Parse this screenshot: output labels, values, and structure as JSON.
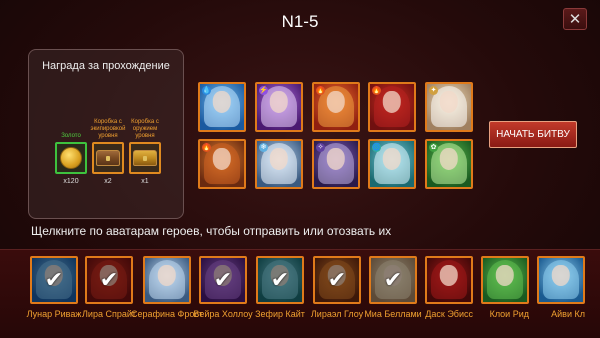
{
  "title": "N1-5",
  "close_label": "✕",
  "reward": {
    "title": "Награда за прохождение",
    "items": [
      {
        "label": "Золото",
        "count": "x120",
        "icon": "gold-coin-icon"
      },
      {
        "label": "Коробка с экипировкой уровня",
        "count": "x2",
        "icon": "equipment-box-icon"
      },
      {
        "label": "Коробка с оружием уровня",
        "count": "x1",
        "icon": "weapon-box-icon"
      }
    ]
  },
  "team": [
    {
      "element": "water",
      "c1": "#1a5aa0",
      "c2": "#7ac0f0",
      "hair": "#bfe4ff"
    },
    {
      "element": "lightning",
      "c1": "#4a1a70",
      "c2": "#b070e0",
      "hair": "#e8d0f8"
    },
    {
      "element": "fire",
      "c1": "#902010",
      "c2": "#f07030",
      "hair": "#f0a040"
    },
    {
      "element": "fire",
      "c1": "#701010",
      "c2": "#d03020",
      "hair": "#b82020"
    },
    {
      "element": "light",
      "c1": "#a08060",
      "c2": "#f0e0c0",
      "hair": "#ffffff"
    },
    {
      "element": "fire",
      "c1": "#6a2a10",
      "c2": "#e08030",
      "hair": "#d06020"
    },
    {
      "element": "ice",
      "c1": "#3a5a80",
      "c2": "#c0d8f0",
      "hair": "#f0f8ff"
    },
    {
      "element": "dark",
      "c1": "#2a1a4a",
      "c2": "#8060c0",
      "hair": "#c0b0e0"
    },
    {
      "element": "wind",
      "c1": "#1a6a70",
      "c2": "#80d0e0",
      "hair": "#e0f8ff"
    },
    {
      "element": "nature",
      "c1": "#1a5a20",
      "c2": "#60c050",
      "hair": "#c0f0a0"
    }
  ],
  "start_button": "НАЧАТЬ БИТВУ",
  "hint": "Щелкните по аватарам героев, чтобы отправить или отозвать их",
  "roster": [
    {
      "name": "Лунар Риваж",
      "selected": true,
      "c1": "#1a5aa0",
      "c2": "#7ac0f0"
    },
    {
      "name": "Лира Спрайт",
      "selected": true,
      "c1": "#701010",
      "c2": "#d03020"
    },
    {
      "name": "Серафина Фрост",
      "selected": false,
      "c1": "#3a5a80",
      "c2": "#c0d8f0"
    },
    {
      "name": "Вейра Холлоу",
      "selected": true,
      "c1": "#4a1a70",
      "c2": "#b070e0"
    },
    {
      "name": "Зефир Кайт",
      "selected": true,
      "c1": "#1a6a70",
      "c2": "#80d0e0"
    },
    {
      "name": "Лираэл Глоу",
      "selected": true,
      "c1": "#6a2a10",
      "c2": "#e08030"
    },
    {
      "name": "Миа Беллами",
      "selected": true,
      "c1": "#a08060",
      "c2": "#f0e0c0"
    },
    {
      "name": "Даск Эбисс",
      "selected": false,
      "c1": "#400808",
      "c2": "#a01818"
    },
    {
      "name": "Клои Рид",
      "selected": false,
      "c1": "#1a5a20",
      "c2": "#60c050"
    },
    {
      "name": "Айви Кл",
      "selected": false,
      "c1": "#1a5a90",
      "c2": "#90d0f0"
    }
  ],
  "check_glyph": "✔"
}
